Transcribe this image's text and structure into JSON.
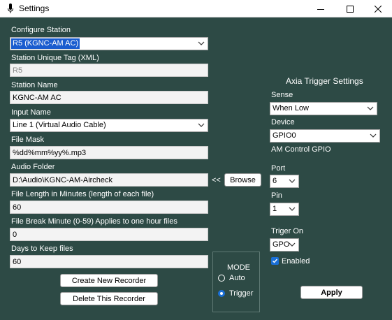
{
  "window": {
    "title": "Settings",
    "controls": [
      "minimize-icon",
      "maximize-icon",
      "close-icon"
    ]
  },
  "left": {
    "configure_station": {
      "label": "Configure Station",
      "value": "R5 (KGNC-AM AC)"
    },
    "station_tag": {
      "label": "Station Unique Tag (XML)",
      "value": "R5"
    },
    "station_name": {
      "label": "Station Name",
      "value": "KGNC-AM AC"
    },
    "input_name": {
      "label": "Input Name",
      "value": "Line 1 (Virtual Audio Cable)"
    },
    "file_mask": {
      "label": "File Mask",
      "value": "%dd%mm%yy%.mp3"
    },
    "audio_folder": {
      "label": "Audio Folder",
      "value": "D:\\Audio\\KGNC-AM-Aircheck",
      "arrow": "<<",
      "browse": "Browse"
    },
    "file_length": {
      "label": "File Length in Minutes (length of each file)",
      "value": "60"
    },
    "file_break": {
      "label": "File Break Minute (0-59) Applies to one hour files",
      "value": "0"
    },
    "days_to_keep": {
      "label": "Days to Keep files",
      "value": "60"
    },
    "create_button": "Create New Recorder",
    "delete_button": "Delete This Recorder"
  },
  "mode": {
    "title": "MODE",
    "options": [
      "Auto",
      "Trigger"
    ],
    "selected": "Trigger"
  },
  "axia": {
    "heading": "Axia Trigger Settings",
    "sense": {
      "label": "Sense",
      "value": "When Low"
    },
    "device": {
      "label": "Device",
      "value": "GPIO0",
      "description": "AM Control GPIO"
    },
    "port": {
      "label": "Port",
      "value": "6"
    },
    "pin": {
      "label": "Pin",
      "value": "1"
    },
    "trigger_on": {
      "label": "Triger On",
      "value": "GPO"
    },
    "enabled": {
      "label": "Enabled",
      "checked": true
    },
    "apply_button": "Apply"
  },
  "colors": {
    "background": "#2d4a45",
    "accent": "#1a6fd6",
    "selection": "#1a5ccf"
  }
}
